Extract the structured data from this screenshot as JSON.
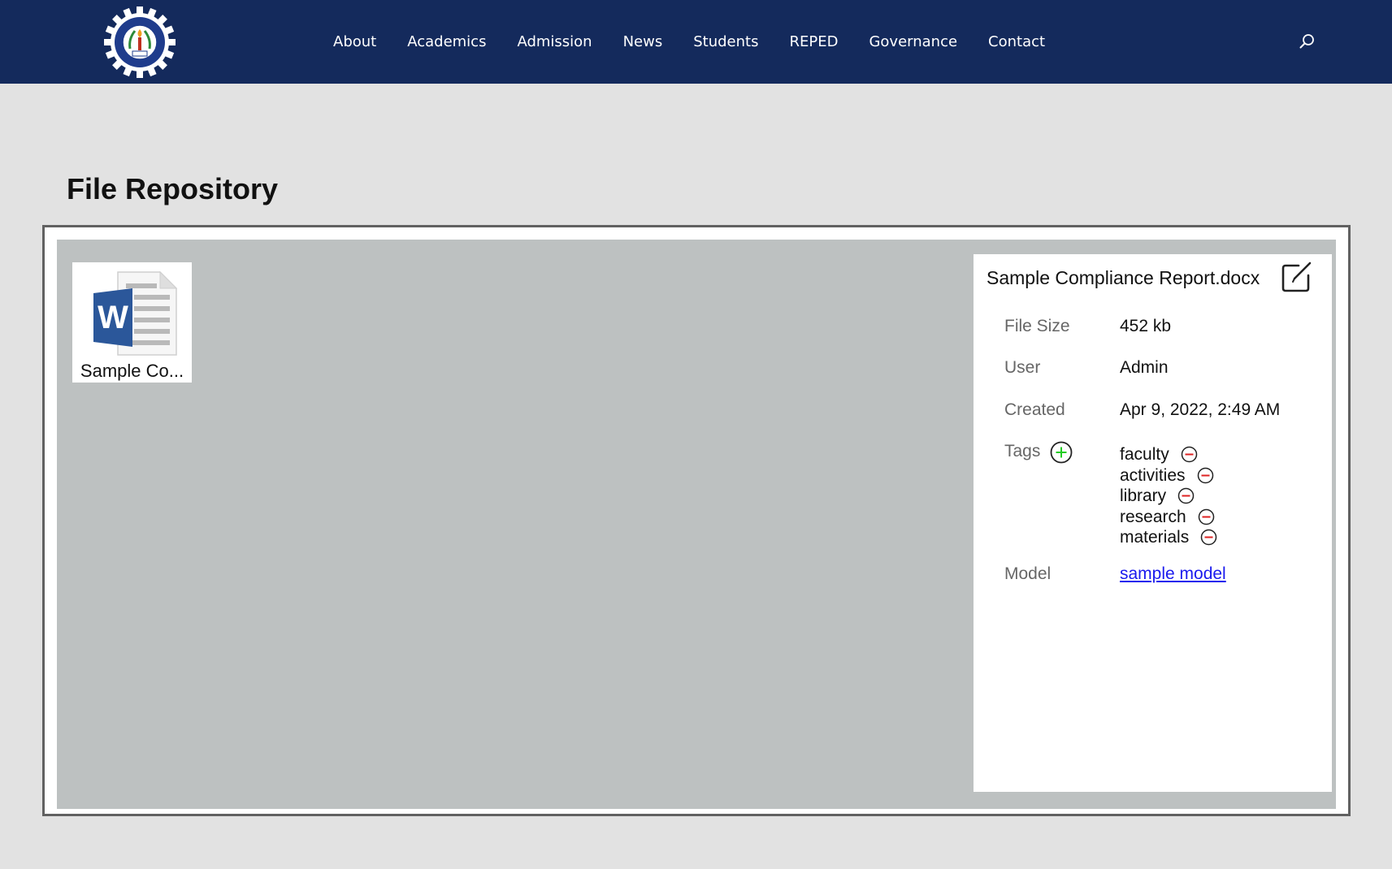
{
  "header": {
    "nav": [
      "About",
      "Academics",
      "Admission",
      "News",
      "Students",
      "REPED",
      "Governance",
      "Contact"
    ],
    "logo_icon": "college-seal-icon",
    "search_icon": "search-icon",
    "background": "#142a5c"
  },
  "page": {
    "title": "File Repository"
  },
  "files": [
    {
      "label": "Sample Co...",
      "icon": "word-document-icon"
    }
  ],
  "details": {
    "filename": "Sample Compliance Report.docx",
    "edit_icon": "edit-icon",
    "file_size_label": "File Size",
    "file_size": "452 kb",
    "user_label": "User",
    "user": "Admin",
    "created_label": "Created",
    "created": "Apr 9, 2022, 2:49 AM",
    "tags_label": "Tags",
    "tags": [
      "faculty",
      "activities",
      "library",
      "research",
      "materials"
    ],
    "add_icon": "plus-circle-icon",
    "remove_icon": "minus-circle-icon",
    "model_label": "Model",
    "model": "sample model"
  },
  "colors": {
    "navy": "#142a5c",
    "page_bg": "#e2e2e2",
    "panel_bg": "#bdc1c1",
    "link": "#1a1aee",
    "add_green": "#22cc22",
    "remove_red": "#dd2222"
  }
}
